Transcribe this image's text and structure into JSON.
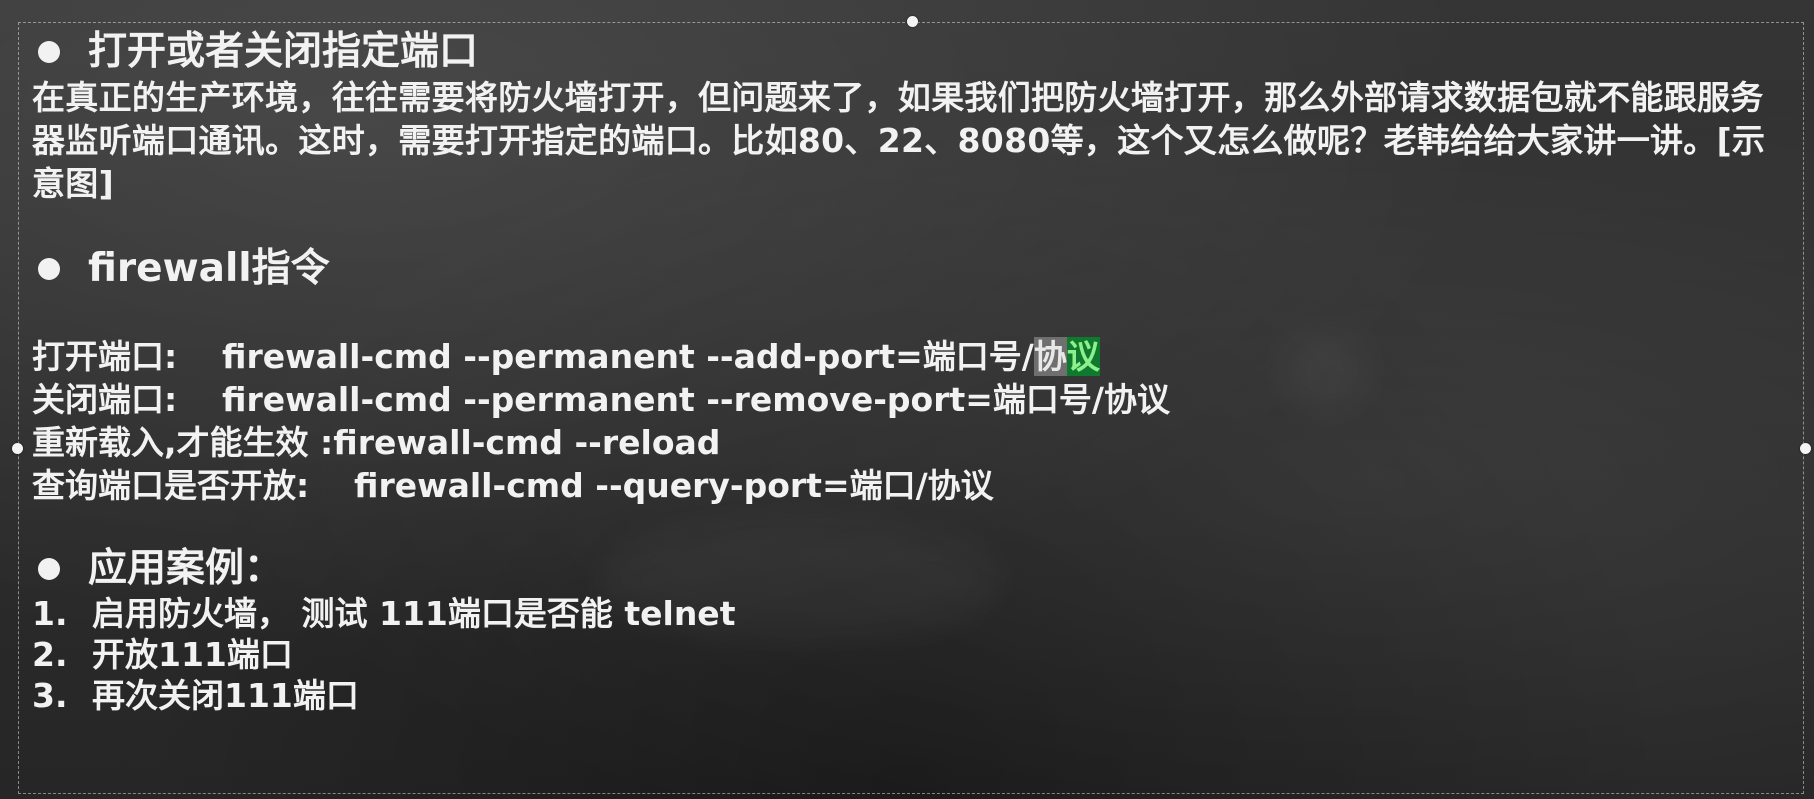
{
  "section1": {
    "heading": "打开或者关闭指定端口",
    "paragraph": "在真正的生产环境，往往需要将防火墙打开，但问题来了，如果我们把防火墙打开，那么外部请求数据包就不能跟服务器监听端口通讯。这时，需要打开指定的端口。比如80、22、8080等，这个又怎么做呢？老韩给给大家讲一讲。[示意图]"
  },
  "section2": {
    "heading": "firewall指令",
    "commands": [
      {
        "label": "打开端口:",
        "cmd": "firewall-cmd --permanent --add-port=端口号/",
        "sel_a": "协",
        "sel_b": "议"
      },
      {
        "label": "关闭端口:",
        "cmd": "firewall-cmd --permanent --remove-port=端口号/协议"
      },
      {
        "label": "重新载入,才能生效 :",
        "cmd": "firewall-cmd --reload"
      },
      {
        "label": "查询端口是否开放:",
        "cmd": "firewall-cmd --query-port=端口/协议"
      }
    ]
  },
  "section3": {
    "heading": "应用案例：",
    "items": [
      {
        "num": "1.",
        "text": "启用防火墙， 测试 111端口是否能 telnet"
      },
      {
        "num": "2.",
        "text": "开放111端口"
      },
      {
        "num": "3.",
        "text": "再次关闭111端口"
      }
    ]
  },
  "colors": {
    "background": "#2c2c2c",
    "text": "#f2f2f2",
    "selection": "#6f6f6f",
    "highlight": "#0f7a2e"
  }
}
